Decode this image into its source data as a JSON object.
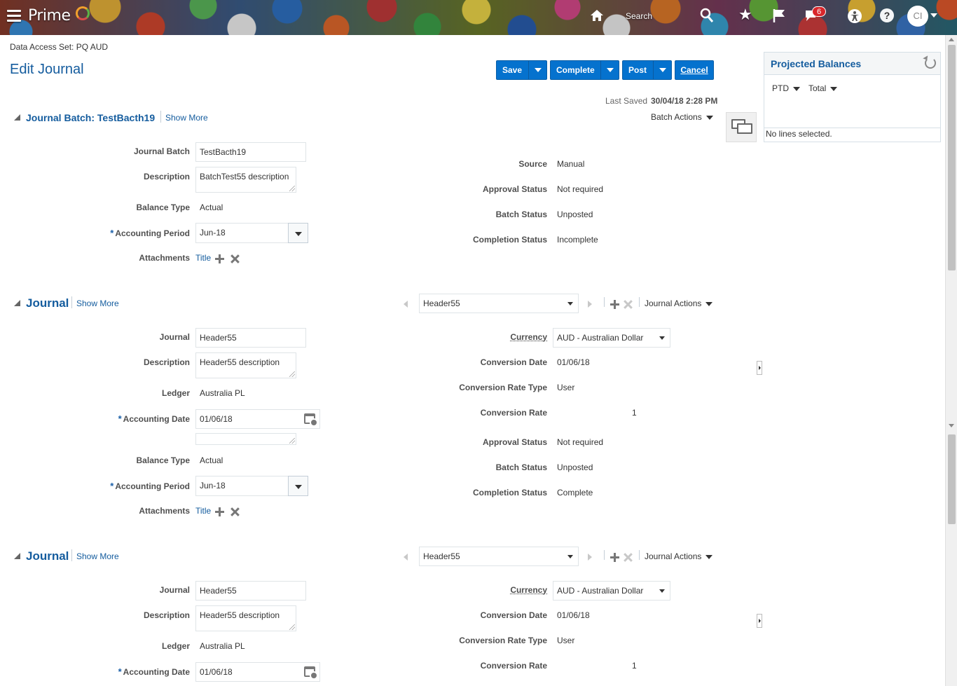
{
  "topbar": {
    "logo_text": "Prime",
    "search_label": "Search",
    "notification_count": "6",
    "avatar_initials": "CI"
  },
  "page": {
    "data_access_set": "Data Access Set:  PQ AUD",
    "title": "Edit Journal",
    "last_saved_label": "Last Saved",
    "last_saved_value": "30/04/18 2:28 PM"
  },
  "toolbar": {
    "save": "Save",
    "complete": "Complete",
    "post": "Post",
    "cancel": "Cancel"
  },
  "batch": {
    "title": "Journal Batch: TestBacth19",
    "show_more": "Show More",
    "batch_actions": "Batch Actions",
    "labels": {
      "journal_batch": "Journal Batch",
      "description": "Description",
      "balance_type": "Balance Type",
      "accounting_period": "Accounting Period",
      "attachments": "Attachments",
      "source": "Source",
      "approval_status": "Approval Status",
      "batch_status": "Batch Status",
      "completion_status": "Completion Status"
    },
    "values": {
      "journal_batch": "TestBacth19",
      "description": "BatchTest55 description",
      "balance_type": "Actual",
      "accounting_period": "Jun-18",
      "attachments_link": "Title",
      "source": "Manual",
      "approval_status": "Not required",
      "batch_status": "Unposted",
      "completion_status": "Incomplete"
    }
  },
  "journals": [
    {
      "title": "Journal",
      "show_more": "Show More",
      "selector": "Header55",
      "journal_actions": "Journal Actions",
      "labels": {
        "journal": "Journal",
        "description": "Description",
        "ledger": "Ledger",
        "accounting_date": "Accounting Date",
        "balance_type": "Balance Type",
        "accounting_period": "Accounting Period",
        "attachments": "Attachments",
        "currency": "Currency",
        "conversion_date": "Conversion Date",
        "conversion_rate_type": "Conversion Rate Type",
        "conversion_rate": "Conversion Rate",
        "approval_status": "Approval Status",
        "batch_status": "Batch Status",
        "completion_status": "Completion Status"
      },
      "values": {
        "journal": "Header55",
        "description": "Header55 description",
        "ledger": "Australia PL",
        "accounting_date": "01/06/18",
        "balance_type": "Actual",
        "accounting_period": "Jun-18",
        "attachments_link": "Title",
        "currency": "AUD - Australian Dollar",
        "conversion_date": "01/06/18",
        "conversion_rate_type": "User",
        "conversion_rate": "1",
        "approval_status": "Not required",
        "batch_status": "Unposted",
        "completion_status": "Complete"
      }
    },
    {
      "title": "Journal",
      "show_more": "Show More",
      "selector": "Header55",
      "journal_actions": "Journal Actions",
      "labels": {
        "journal": "Journal",
        "description": "Description",
        "ledger": "Ledger",
        "accounting_date": "Accounting Date",
        "currency": "Currency",
        "conversion_date": "Conversion Date",
        "conversion_rate_type": "Conversion Rate Type",
        "conversion_rate": "Conversion Rate"
      },
      "values": {
        "journal": "Header55",
        "description": "Header55 description",
        "ledger": "Australia PL",
        "accounting_date": "01/06/18",
        "currency": "AUD - Australian Dollar",
        "conversion_date": "01/06/18",
        "conversion_rate_type": "User",
        "conversion_rate": "1"
      }
    }
  ],
  "projected_balances": {
    "title": "Projected Balances",
    "period_type": "PTD",
    "amount_type": "Total",
    "empty_text": "No lines selected."
  }
}
